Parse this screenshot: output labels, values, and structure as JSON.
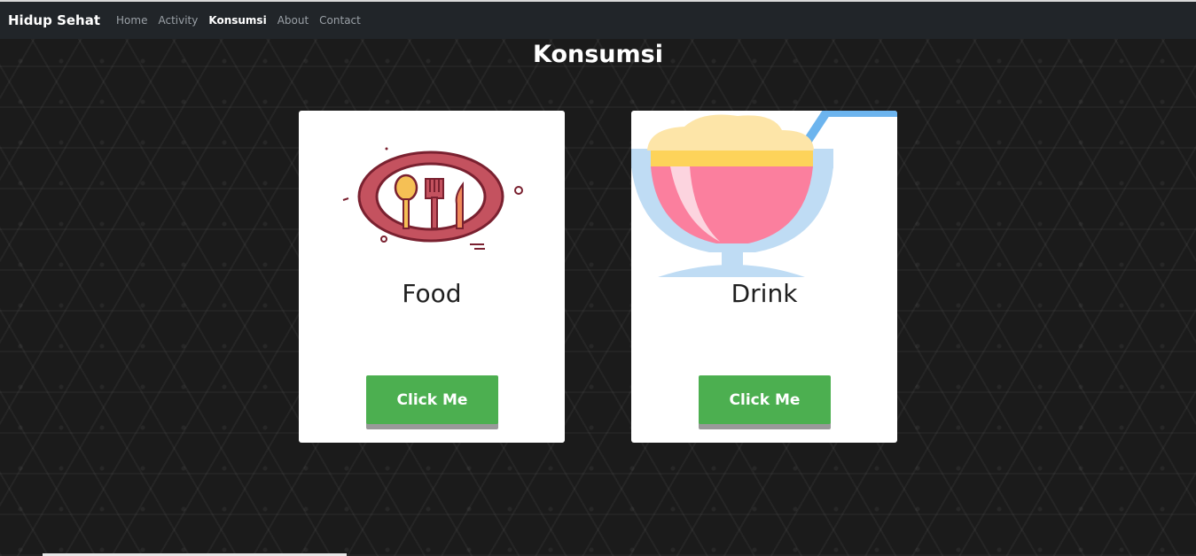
{
  "navbar": {
    "brand": "Hidup Sehat",
    "links": [
      "Home",
      "Activity",
      "Konsumsi",
      "About",
      "Contact"
    ],
    "active": "Konsumsi"
  },
  "page": {
    "title": "Konsumsi"
  },
  "cards": [
    {
      "title": "Food",
      "button": "Click Me",
      "image": "plate-with-cutlery-icon"
    },
    {
      "title": "Drink",
      "button": "Click Me",
      "image": "milkshake-glass-icon"
    }
  ],
  "colors": {
    "navbar_bg": "#212529",
    "button_green": "#4caf50",
    "button_shadow": "#999999",
    "page_bg": "#1b1b1b"
  }
}
